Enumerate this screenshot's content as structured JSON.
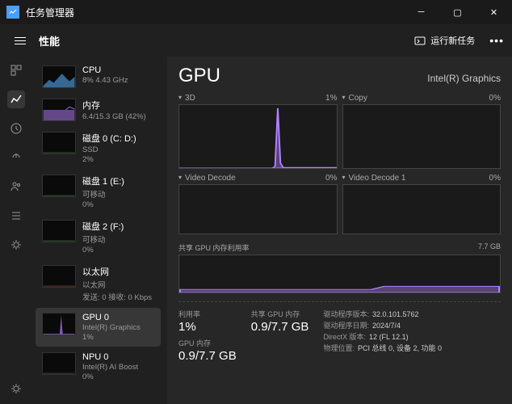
{
  "title": "任务管理器",
  "performance_tab": "性能",
  "new_task": "运行新任务",
  "sidebar": [
    {
      "name": "CPU",
      "sub": "8%  4.43 GHz"
    },
    {
      "name": "内存",
      "sub": "6.4/15.3 GB (42%)"
    },
    {
      "name": "磁盘 0 (C: D:)",
      "sub": "SSD",
      "sub2": "2%"
    },
    {
      "name": "磁盘 1 (E:)",
      "sub": "可移动",
      "sub2": "0%"
    },
    {
      "name": "磁盘 2 (F:)",
      "sub": "可移动",
      "sub2": "0%"
    },
    {
      "name": "以太网",
      "sub": "以太网",
      "sub2": "发送: 0 接收: 0 Kbps"
    },
    {
      "name": "GPU 0",
      "sub": "Intel(R) Graphics",
      "sub2": "1%"
    },
    {
      "name": "NPU 0",
      "sub": "Intel(R) AI Boost",
      "sub2": "0%"
    }
  ],
  "detail": {
    "title": "GPU",
    "model": "Intel(R) Graphics",
    "charts": [
      {
        "label": "3D",
        "pct": "1%"
      },
      {
        "label": "Copy",
        "pct": "0%"
      },
      {
        "label": "Video Decode",
        "pct": "0%"
      },
      {
        "label": "Video Decode 1",
        "pct": "0%"
      }
    ],
    "shared_label": "共享 GPU 内存利用率",
    "shared_max": "7.7 GB",
    "stats": {
      "util_label": "利用率",
      "util": "1%",
      "shared_label": "共享 GPU 内存",
      "shared": "0.9/7.7 GB",
      "mem_label": "GPU 内存",
      "mem": "0.9/7.7 GB"
    },
    "info": {
      "driver_ver_label": "驱动程序版本:",
      "driver_ver": "32.0.101.5762",
      "driver_date_label": "驱动程序日期:",
      "driver_date": "2024/7/4",
      "directx_label": "DirectX 版本:",
      "directx": "12 (FL 12.1)",
      "location_label": "物理位置:",
      "location": "PCI 总线 0, 设备 2, 功能 0"
    }
  },
  "chart_data": {
    "type": "line",
    "title": "GPU 3D 利用率",
    "ylabel": "%",
    "ylim": [
      0,
      100
    ],
    "series": [
      {
        "name": "3D",
        "values": [
          0,
          0,
          0,
          0,
          0,
          0,
          0,
          0,
          0,
          0,
          0,
          0,
          0,
          0,
          0,
          0,
          0,
          0,
          0,
          0,
          0,
          0,
          0,
          0,
          0,
          0,
          0,
          0,
          0,
          0,
          0,
          0,
          0,
          0,
          0,
          0,
          3,
          95,
          8,
          1,
          1,
          1,
          1,
          1,
          1,
          1,
          1,
          1,
          1,
          1,
          1,
          1,
          1,
          1,
          1,
          1,
          1,
          1,
          1,
          1
        ]
      }
    ]
  }
}
